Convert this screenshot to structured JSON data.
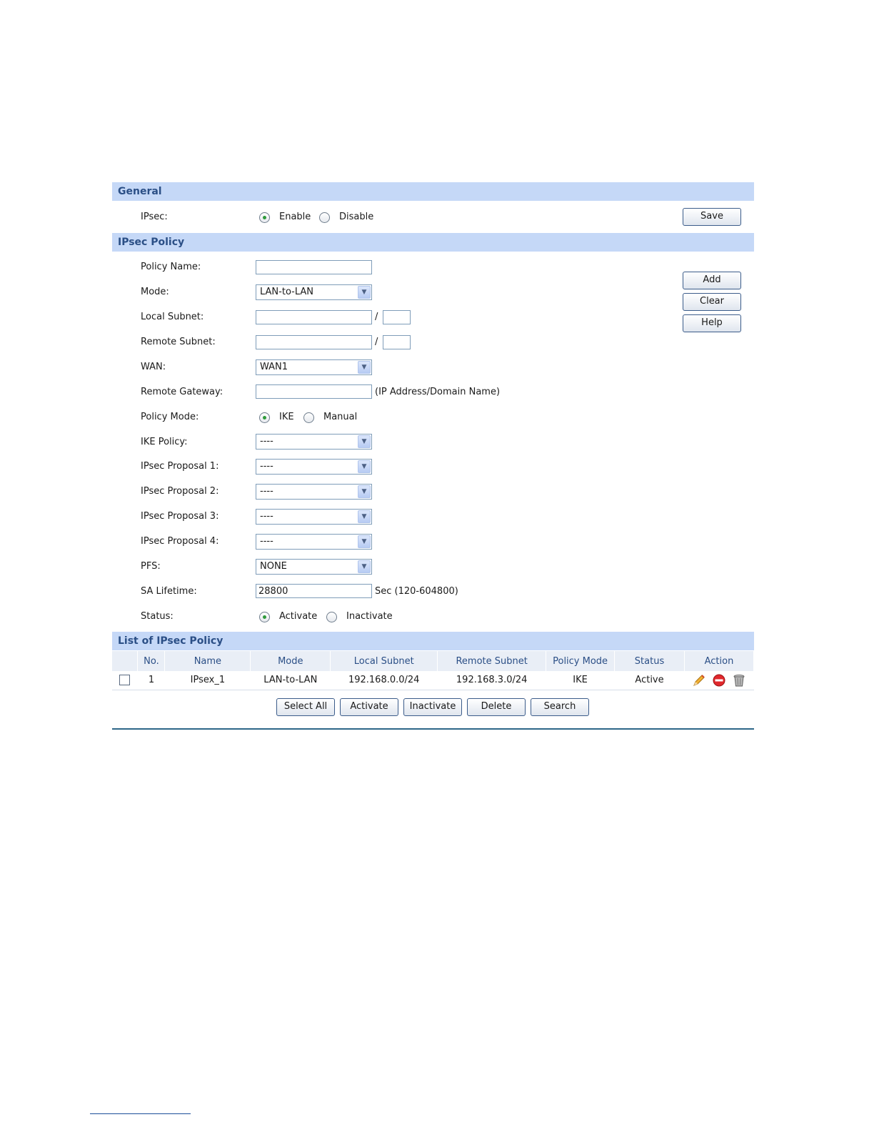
{
  "general": {
    "header": "General",
    "ipsec_label": "IPsec:",
    "enable_label": "Enable",
    "disable_label": "Disable",
    "enabled": true,
    "save_label": "Save"
  },
  "policy": {
    "header": "IPsec Policy",
    "fields": {
      "policy_name_label": "Policy Name:",
      "mode_label": "Mode:",
      "mode_value": "LAN-to-LAN",
      "local_subnet_label": "Local Subnet:",
      "remote_subnet_label": "Remote Subnet:",
      "slash": "/",
      "wan_label": "WAN:",
      "wan_value": "WAN1",
      "remote_gateway_label": "Remote Gateway:",
      "remote_gateway_hint": "(IP Address/Domain Name)",
      "policy_mode_label": "Policy Mode:",
      "ike_label": "IKE",
      "manual_label": "Manual",
      "ike_policy_label": "IKE Policy:",
      "ike_policy_value": "----",
      "proposal1_label": "IPsec Proposal 1:",
      "proposal1_value": "----",
      "proposal2_label": "IPsec Proposal 2:",
      "proposal2_value": "----",
      "proposal3_label": "IPsec Proposal 3:",
      "proposal3_value": "----",
      "proposal4_label": "IPsec Proposal 4:",
      "proposal4_value": "----",
      "pfs_label": "PFS:",
      "pfs_value": "NONE",
      "sa_lifetime_label": "SA Lifetime:",
      "sa_lifetime_value": "28800",
      "sa_lifetime_hint": "Sec (120-604800)",
      "status_label": "Status:",
      "activate_label": "Activate",
      "inactivate_label": "Inactivate"
    },
    "buttons": {
      "add": "Add",
      "clear": "Clear",
      "help": "Help"
    }
  },
  "list": {
    "header": "List of IPsec Policy",
    "columns": [
      "No.",
      "Name",
      "Mode",
      "Local Subnet",
      "Remote Subnet",
      "Policy Mode",
      "Status",
      "Action"
    ],
    "rows": [
      {
        "no": "1",
        "name": "IPsex_1",
        "mode": "LAN-to-LAN",
        "local": "192.168.0.0/24",
        "remote": "192.168.3.0/24",
        "policy_mode": "IKE",
        "status": "Active"
      }
    ],
    "buttons": {
      "select_all": "Select All",
      "activate": "Activate",
      "inactivate": "Inactivate",
      "delete": "Delete",
      "search": "Search"
    }
  },
  "icons": {
    "edit": "pencil-icon",
    "disable": "no-entry-icon",
    "delete": "trash-icon"
  },
  "colors": {
    "header_bg": "#c5d8f7",
    "header_text": "#2b4f86",
    "radio_dot": "#2f9a3b",
    "rule": "#2e6688"
  }
}
